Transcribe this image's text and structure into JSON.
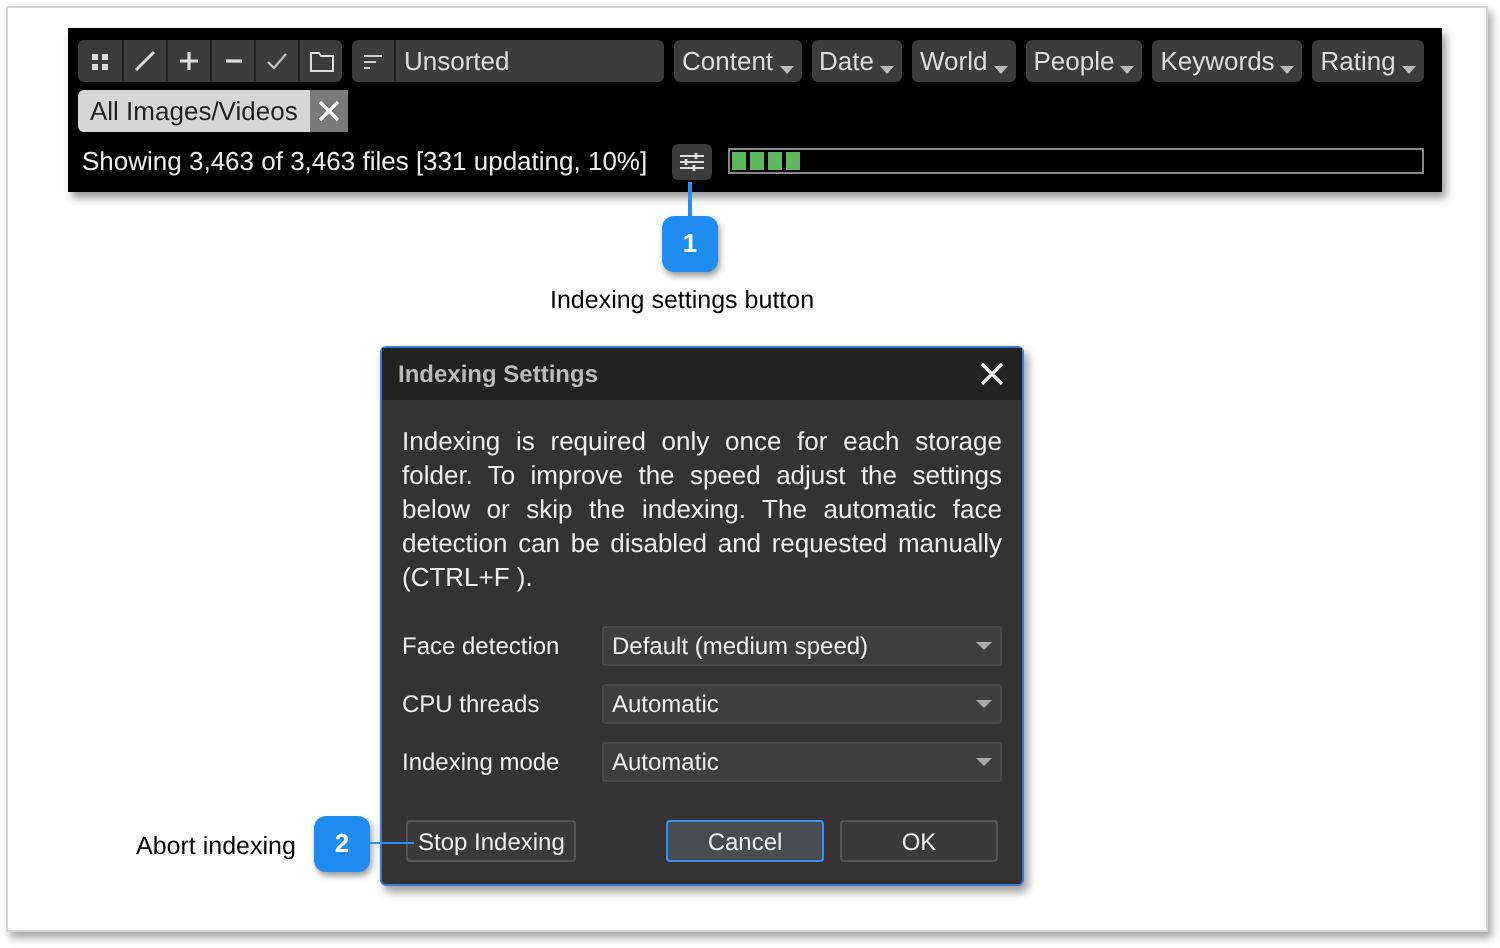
{
  "toolbar": {
    "sort": {
      "value": "Unsorted"
    },
    "filters": [
      "Content",
      "Date",
      "World",
      "People",
      "Keywords",
      "Rating"
    ],
    "tag": {
      "label": "All Images/Videos"
    },
    "status": "Showing 3,463 of 3,463 files [331 updating, 10%]",
    "progress": {
      "level": 0.1
    }
  },
  "callouts": [
    {
      "number": "1",
      "label": "Indexing settings button"
    },
    {
      "number": "2",
      "label": "Abort indexing"
    }
  ],
  "dialog": {
    "title": "Indexing Settings",
    "message": "Indexing is required only once for each storage folder. To improve the speed adjust the settings below or skip the indexing. The automatic face detection can be disabled and requested manually (CTRL+F ).",
    "fields": [
      {
        "label": "Face detection",
        "value": "Default (medium speed)"
      },
      {
        "label": "CPU threads",
        "value": "Automatic"
      },
      {
        "label": "Indexing mode",
        "value": "Automatic"
      }
    ],
    "stop_button": "Stop Indexing",
    "buttons": [
      {
        "label": "Cancel",
        "focused": true
      },
      {
        "label": "OK",
        "focused": false
      }
    ]
  }
}
